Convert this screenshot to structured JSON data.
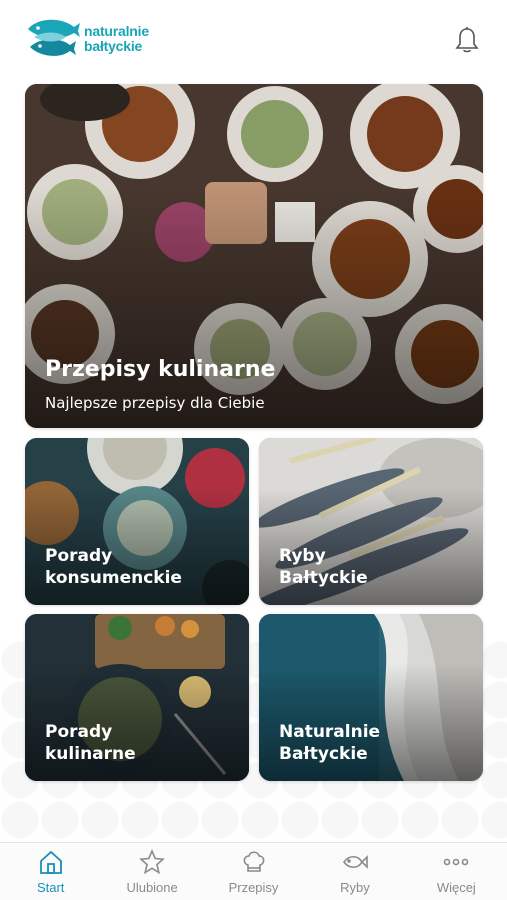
{
  "header": {
    "logo_line1": "naturalnie",
    "logo_line2": "bałtyckie",
    "brand_color": "#1aa5b8",
    "icon": "bell-icon"
  },
  "hero": {
    "title": "Przepisy kulinarne",
    "subtitle": "Najlepsze przepisy dla Ciebie"
  },
  "tiles": [
    {
      "line1": "Porady",
      "line2": "konsumenckie"
    },
    {
      "line1": "Ryby",
      "line2": "Bałtyckie"
    },
    {
      "line1": "Porady",
      "line2": "kulinarne"
    },
    {
      "line1": "Naturalnie",
      "line2": "Bałtyckie"
    }
  ],
  "nav": {
    "active_color": "#1a8fb8",
    "inactive_color": "#8a8a8a",
    "items": [
      {
        "label": "Start",
        "icon": "home-icon",
        "active": true
      },
      {
        "label": "Ulubione",
        "icon": "star-icon"
      },
      {
        "label": "Przepisy",
        "icon": "chef-hat-icon"
      },
      {
        "label": "Ryby",
        "icon": "fish-icon"
      },
      {
        "label": "Więcej",
        "icon": "more-dots-icon"
      }
    ]
  }
}
